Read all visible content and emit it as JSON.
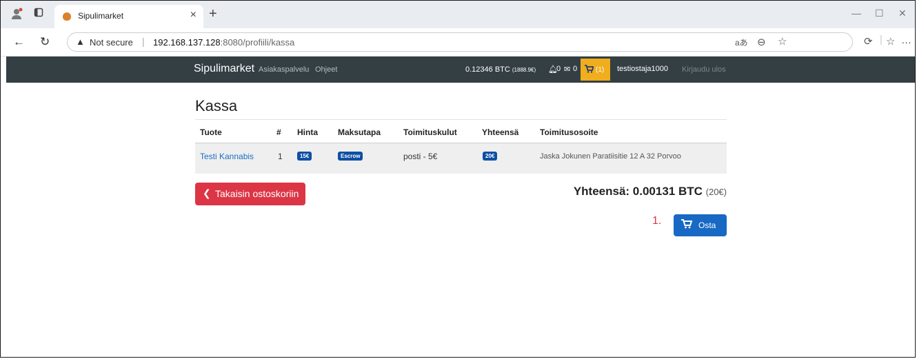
{
  "browser": {
    "tab_title": "Sipulimarket",
    "tab_close": "×",
    "new_tab": "+",
    "security_label": "Not secure",
    "url_host": "192.168.137.128",
    "url_rest": ":8080/profiili/kassa"
  },
  "navbar": {
    "brand": "Sipulimarket",
    "links": [
      "Asiakaspalvelu",
      "Ohjeet"
    ],
    "wallet_btc": "0.12346 BTC",
    "wallet_eur": "(1888.9€)",
    "notifications": "0",
    "messages": "0",
    "cart_count": "(1)",
    "username": "testiostaja1000",
    "logout": "Kirjaudu ulos"
  },
  "page": {
    "title": "Kassa",
    "columns": [
      "Tuote",
      "#",
      "Hinta",
      "Maksutapa",
      "Toimituskulut",
      "Yhteensä",
      "Toimitusosoite"
    ],
    "rows": [
      {
        "product": "Testi Kannabis",
        "qty": "1",
        "price": "15€",
        "payment": "Escrow",
        "shipping": "posti - 5€",
        "total": "20€",
        "address": "Jaska Jokunen Paratiisitie 12 A 32 Porvoo"
      }
    ],
    "back_button": "Takaisin ostoskoriin",
    "total_label": "Yhteensä: 0.00131 BTC",
    "total_eur": "(20€)",
    "step_marker": "1.",
    "buy_button": "Osta"
  },
  "icons": {
    "profile": "profile-icon",
    "tabs": "tab-actions-icon",
    "warning": "warning-icon",
    "bell": "bell-icon",
    "mail": "envelope-icon",
    "cart": "cart-icon"
  },
  "colors": {
    "navbar_bg": "#343f44",
    "cart_bg": "#f0ad1d",
    "back_button": "#dc3545",
    "buy_button": "#1769c4",
    "badge": "#0d4fa3",
    "link": "#1c6ec2"
  }
}
